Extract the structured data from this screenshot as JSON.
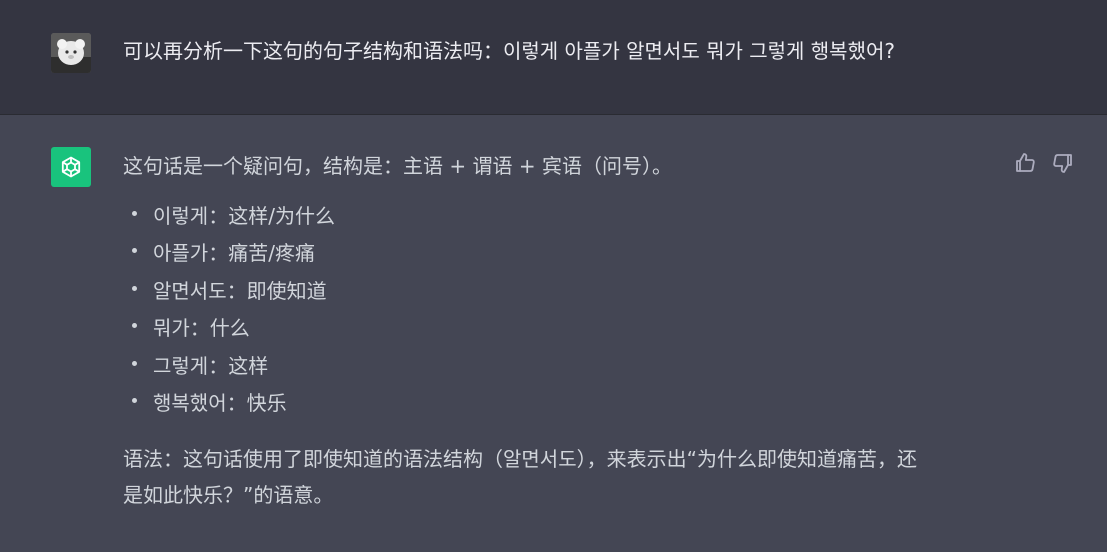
{
  "user_message": {
    "text": "可以再分析一下这句的句子结构和语法吗：이렇게 아플가 알면서도 뭐가 그렇게 행복했어?"
  },
  "assistant_message": {
    "intro": "这句话是一个疑问句，结构是：主语 + 谓语 + 宾语（问号）。",
    "items": [
      "이렇게：这样/为什么",
      "아플가：痛苦/疼痛",
      "알면서도：即使知道",
      "뭐가：什么",
      "그렇게：这样",
      "행복했어：快乐"
    ],
    "grammar": "语法：这句话使用了即使知道的语法结构（알면서도），来表示出“为什么即使知道痛苦，还\n是如此快乐？”的语意。"
  },
  "icons": {
    "user_avatar": "user-avatar-image",
    "assistant_avatar": "openai-logo-icon",
    "like": "thumbs-up-icon",
    "dislike": "thumbs-down-icon"
  },
  "colors": {
    "user_bg": "#343541",
    "assistant_bg": "#444654",
    "brand": "#19c37d"
  }
}
